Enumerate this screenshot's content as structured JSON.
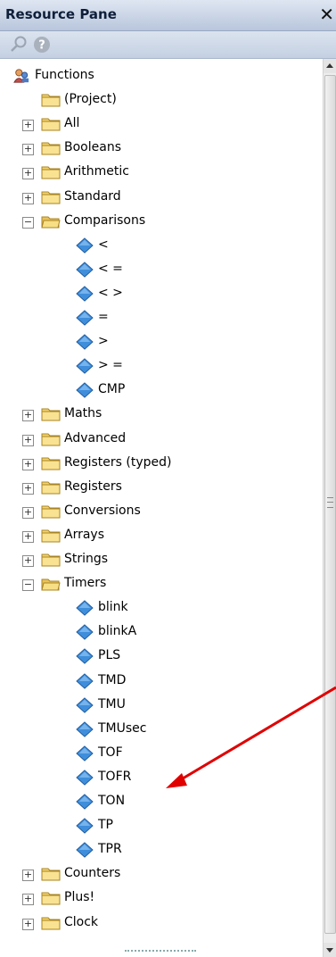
{
  "pane": {
    "title": "Resource Pane",
    "close_label": "✕",
    "toolbar": {
      "search_icon": "search-icon",
      "help_icon": "help-icon"
    }
  },
  "tree": {
    "root": "Functions",
    "project": "(Project)",
    "groups_top": [
      "All",
      "Booleans",
      "Arithmetic",
      "Standard"
    ],
    "comparisons": {
      "label": "Comparisons",
      "items": [
        "<",
        "< =",
        "< >",
        "=",
        ">",
        "> =",
        "CMP"
      ]
    },
    "groups_mid": [
      "Maths",
      "Advanced",
      "Registers (typed)",
      "Registers",
      "Conversions",
      "Arrays",
      "Strings"
    ],
    "timers": {
      "label": "Timers",
      "items": [
        "blink",
        "blinkA",
        "PLS",
        "TMD",
        "TMU",
        "TMUsec",
        "TOF",
        "TOFR",
        "TON",
        "TP",
        "TPR"
      ]
    },
    "groups_bottom": [
      "Counters",
      "Plus!",
      "Clock"
    ]
  },
  "colors": {
    "annotation_arrow": "#e00000",
    "folder": "#f4d36b",
    "diamond": "#3f8edc"
  }
}
